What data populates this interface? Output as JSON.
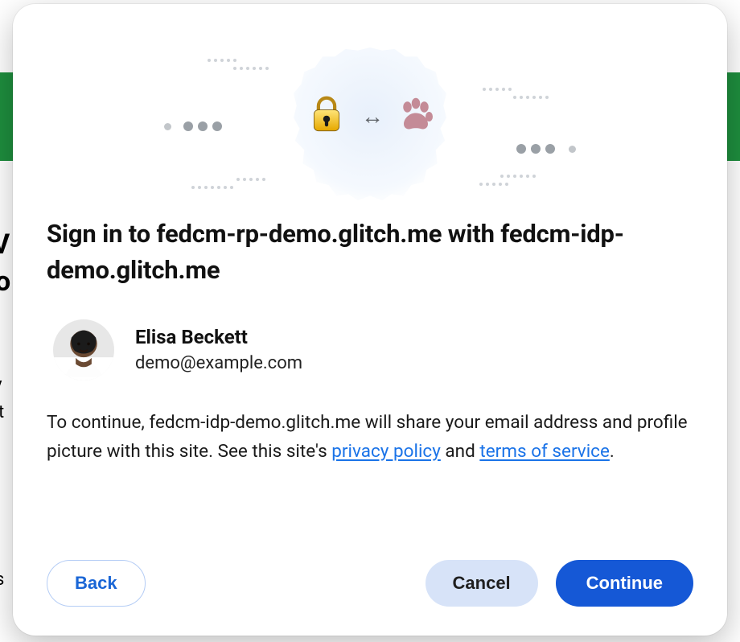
{
  "background": {
    "partial_left_1": "V",
    "partial_left_2": "o",
    "partial_left_3": "v",
    "partial_left_4": "t",
    "partial_left_5": "s"
  },
  "dialog": {
    "title_prefix": "Sign in to ",
    "rp": "fedcm-rp-demo.glitch.me",
    "title_mid": " with ",
    "idp": "fedcm-idp-demo.glitch.me",
    "account": {
      "name": "Elisa Beckett",
      "email": "demo@example.com"
    },
    "disclosure": {
      "pre": "To continue, ",
      "idp_text": "fedcm-idp-demo.glitch.me",
      "mid": " will share your email address and profile picture with this site. See this site's ",
      "privacy_link": "privacy policy",
      "and": " and ",
      "tos_link": "terms of service",
      "end": "."
    },
    "buttons": {
      "back": "Back",
      "cancel": "Cancel",
      "continue": "Continue"
    }
  }
}
